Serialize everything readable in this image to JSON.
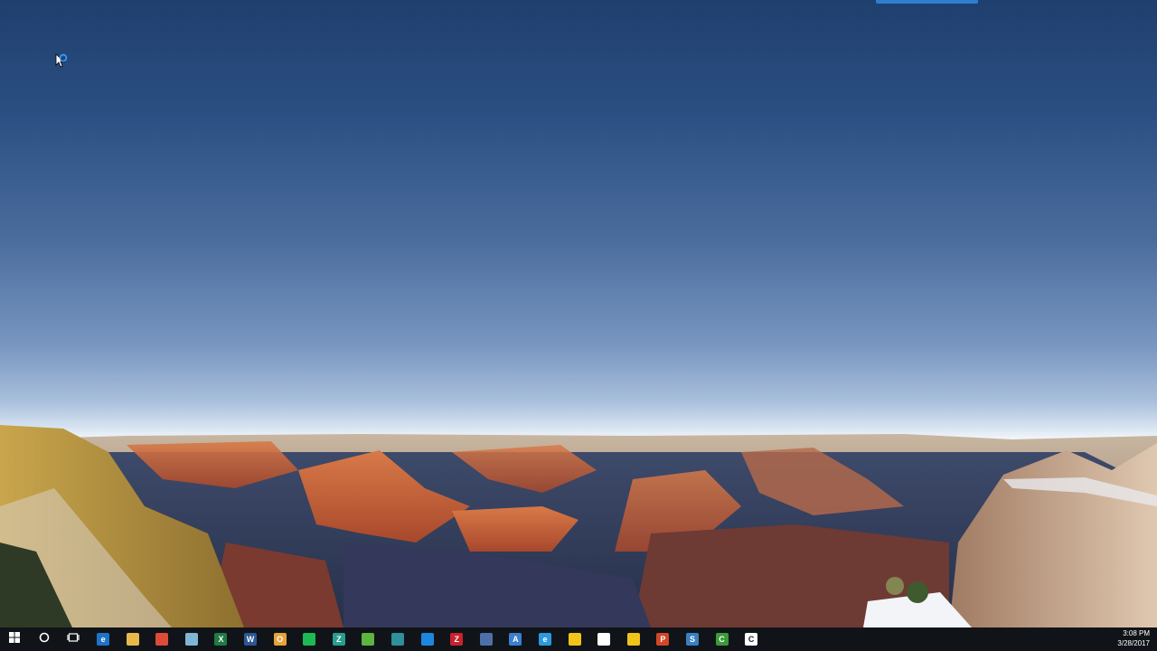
{
  "wallpaper": {
    "description_icon": "grand-canyon-wallpaper"
  },
  "taskbar": {
    "start_icon": "windows-logo-icon",
    "search_icon": "cortana-circle-icon",
    "taskview_icon": "task-view-icon",
    "apps": [
      {
        "name": "edge-icon",
        "letter": "e",
        "color": "#1e73c8"
      },
      {
        "name": "file-explorer-icon",
        "letter": "",
        "color": "#e8b84a"
      },
      {
        "name": "chrome-icon",
        "letter": "",
        "color": "#dd4b39"
      },
      {
        "name": "notepad-icon",
        "letter": "",
        "color": "#7fb6d8"
      },
      {
        "name": "excel-icon",
        "letter": "X",
        "color": "#1f7a44"
      },
      {
        "name": "word-icon",
        "letter": "W",
        "color": "#2b5797"
      },
      {
        "name": "outlook-icon",
        "letter": "O",
        "color": "#e8a33a"
      },
      {
        "name": "spotify-icon",
        "letter": "",
        "color": "#1db954"
      },
      {
        "name": "zoom-icon",
        "letter": "Z",
        "color": "#2a9d8f"
      },
      {
        "name": "evernote-icon",
        "letter": "",
        "color": "#5fb33f"
      },
      {
        "name": "app-teal-icon",
        "letter": "",
        "color": "#2f8f9d"
      },
      {
        "name": "dropbox-icon",
        "letter": "",
        "color": "#1f86e0"
      },
      {
        "name": "filezilla-icon",
        "letter": "Z",
        "color": "#c8232c"
      },
      {
        "name": "network-icon",
        "letter": "",
        "color": "#4f6fa8"
      },
      {
        "name": "app-blue-triangle-icon",
        "letter": "A",
        "color": "#3b7fd0"
      },
      {
        "name": "internet-explorer-icon",
        "letter": "e",
        "color": "#2b9ae0"
      },
      {
        "name": "yellow-runner-icon",
        "letter": "",
        "color": "#f0c419"
      },
      {
        "name": "app-white-icon",
        "letter": "",
        "color": "#ffffff"
      },
      {
        "name": "yellow-runner-2-icon",
        "letter": "",
        "color": "#f0c419"
      },
      {
        "name": "powerpoint-icon",
        "letter": "P",
        "color": "#d24726"
      },
      {
        "name": "snagit-icon",
        "letter": "S",
        "color": "#3a7fbf"
      },
      {
        "name": "camtasia-icon",
        "letter": "C",
        "color": "#3c9a3a"
      },
      {
        "name": "camtasia-recorder-icon",
        "letter": "C",
        "color": "#ffffff"
      }
    ]
  },
  "clock": {
    "time": "3:08 PM",
    "date": "3/28/2017"
  }
}
